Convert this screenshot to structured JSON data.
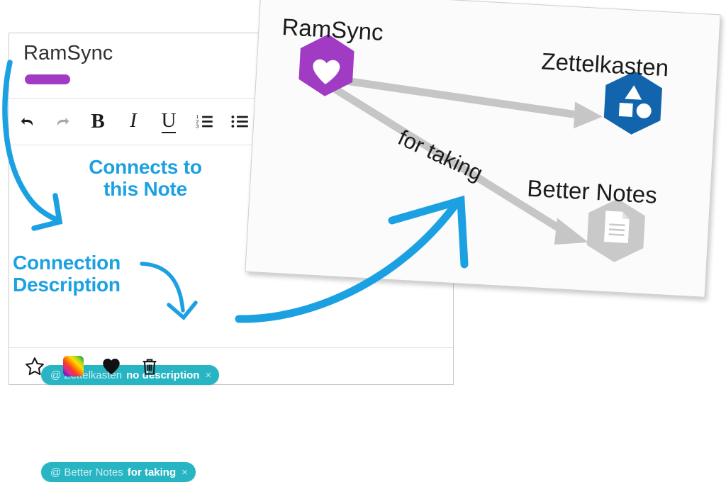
{
  "editor": {
    "note_title": "RamSync",
    "color_bar_hex": "#a13bc4",
    "toolbar": {
      "items": [
        {
          "name": "undo",
          "label": "Undo",
          "state": "enabled"
        },
        {
          "name": "redo",
          "label": "Redo",
          "state": "disabled"
        },
        {
          "name": "bold",
          "label": "B",
          "state": "enabled"
        },
        {
          "name": "italic",
          "label": "I",
          "state": "enabled"
        },
        {
          "name": "underline",
          "label": "U",
          "state": "enabled"
        },
        {
          "name": "ordered-list",
          "label": "Ordered list",
          "state": "enabled"
        },
        {
          "name": "unordered-list",
          "label": "Bullet list",
          "state": "enabled"
        }
      ]
    },
    "connections": [
      {
        "at": "@",
        "target": "Zettelkasten",
        "description": "no description",
        "remove": "×"
      },
      {
        "at": "@",
        "target": "Better Notes",
        "description": "for taking",
        "remove": "×"
      }
    ],
    "actions": [
      {
        "name": "favorite",
        "icon": "star-outline-icon"
      },
      {
        "name": "color",
        "icon": "color-swatch-icon"
      },
      {
        "name": "like",
        "icon": "heart-filled-icon"
      },
      {
        "name": "delete",
        "icon": "trash-icon"
      }
    ],
    "tag_color_hex": "#27b5c4"
  },
  "graph": {
    "nodes": [
      {
        "id": "ramsync",
        "label": "RamSync",
        "color_hex": "#a13bc4",
        "icon": "heart-icon"
      },
      {
        "id": "zettelkasten",
        "label": "Zettelkasten",
        "color_hex": "#1265ad",
        "icon": "shapes-icon"
      },
      {
        "id": "better-notes",
        "label": "Better Notes",
        "color_hex": "#c9c9c9",
        "icon": "document-icon"
      }
    ],
    "edges": [
      {
        "from": "ramsync",
        "to": "zettelkasten",
        "label": ""
      },
      {
        "from": "ramsync",
        "to": "better-notes",
        "label": "for taking"
      }
    ],
    "edge_color_hex": "#c6c6c6"
  },
  "annotations": {
    "color_hex": "#1ba1e2",
    "connects_to_note": "Connects to\nthis Note",
    "connects_to_note_line1": "Connects to",
    "connects_to_note_line2": "this Note",
    "connection_description_line1": "Connection",
    "connection_description_line2": "Description"
  }
}
